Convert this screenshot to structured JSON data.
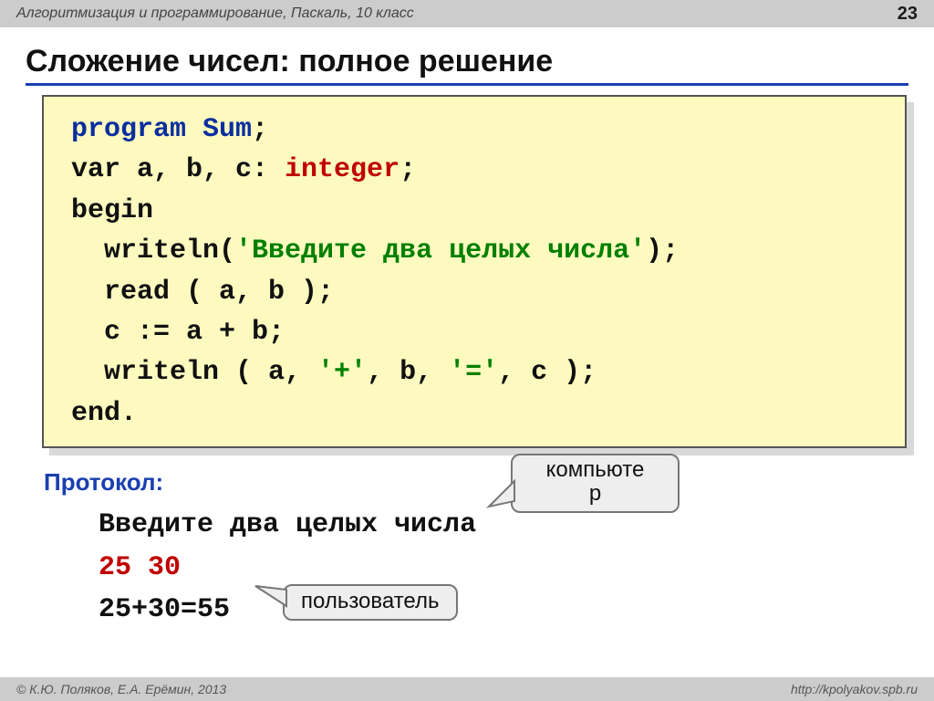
{
  "header": {
    "course": "Алгоритмизация и программирование, Паскаль, 10 класс",
    "page": "23"
  },
  "title": "Сложение чисел: полное решение",
  "code": {
    "l1a": "program ",
    "l1b": "Sum",
    "l1c": ";",
    "l2a": "var a, b, c: ",
    "l2b": "integer",
    "l2c": ";",
    "l3": "begin",
    "l4a": "  writeln(",
    "l4b": "'Введите два целых числа'",
    "l4c": ");",
    "l5": "  read ( a, b );",
    "l6": "  c := a + b;",
    "l7a": "  writeln ( a, ",
    "l7b": "'+'",
    "l7c": ", b, ",
    "l7d": "'='",
    "l7e": ", c );",
    "l8": "end."
  },
  "protocol": {
    "label": "Протокол:",
    "line1": "Введите два целых числа",
    "line2": "25 30",
    "line3": "25+30=55"
  },
  "callouts": {
    "computer": "компьюте\nр",
    "user": "пользователь"
  },
  "footer": {
    "left": "© К.Ю. Поляков, Е.А. Ерёмин, 2013",
    "right": "http://kpolyakov.spb.ru"
  }
}
